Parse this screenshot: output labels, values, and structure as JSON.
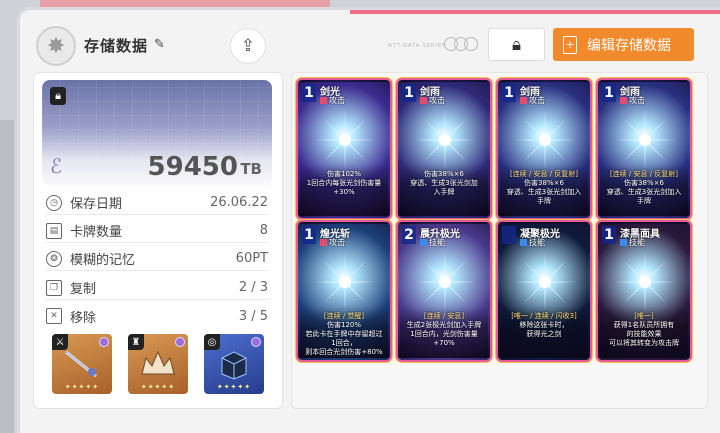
{
  "header": {
    "title": "存储数据",
    "brand_text": "NTT-DATA-SERIES",
    "edit_label": "编辑存储数据"
  },
  "storage": {
    "value": "59450",
    "unit": "TB"
  },
  "stats": [
    {
      "label": "保存日期",
      "value": "26.06.22",
      "icon": "clock-icon"
    },
    {
      "label": "卡牌数量",
      "value": "8",
      "icon": "cards-icon"
    },
    {
      "label": "模糊的记忆",
      "value": "60PT",
      "icon": "brain-icon"
    },
    {
      "label": "复制",
      "value": "2 / 3",
      "icon": "copy-icon"
    },
    {
      "label": "移除",
      "value": "3 / 5",
      "icon": "remove-icon"
    }
  ],
  "equipment": [
    {
      "stars": "✦✦✦✦✦",
      "color": "#c8803c",
      "badge": "⚔"
    },
    {
      "stars": "✦✦✦✦✦",
      "color": "#c8803c",
      "badge": "👕"
    },
    {
      "stars": "✦✦✦✦✦",
      "color": "#3a5bb8",
      "badge": "💍"
    }
  ],
  "cards": [
    {
      "cost": "1",
      "name": "剑光",
      "type": "攻击",
      "typeColor": "#e84a6a",
      "desc": [
        "伤害102%",
        "1回合内每张光剑伤害量",
        "+30%"
      ],
      "bg": "#3b2b8e"
    },
    {
      "cost": "1",
      "name": "剑雨",
      "type": "攻击",
      "typeColor": "#e84a6a",
      "desc": [
        "伤害38%×6",
        "穿透、生成3张光剑加",
        "入手牌"
      ],
      "bg": "#2f2a78"
    },
    {
      "cost": "1",
      "name": "剑雨",
      "type": "攻击",
      "typeColor": "#e84a6a",
      "desc": [
        "[连续 / 安息 / 反复射]",
        "伤害38%×6",
        "穿透、生成3张光剑加入手牌"
      ],
      "bg": "#2a3080"
    },
    {
      "cost": "1",
      "name": "剑雨",
      "type": "攻击",
      "typeColor": "#e84a6a",
      "desc": [
        "[连续 / 安息 / 反复射]",
        "伤害38%×6",
        "穿透、生成3张光剑加入手牌"
      ],
      "bg": "#2a3080"
    },
    {
      "cost": "1",
      "name": "煌光斩",
      "type": "攻击",
      "typeColor": "#e84a6a",
      "desc": [
        "[连续 / 觉醒]",
        "伤害120%",
        "若此卡在手牌中存留超过1回合，",
        "则本回合光剑伤害+80%"
      ],
      "bg": "#1d3f7a"
    },
    {
      "cost": "2",
      "name": "晨升极光",
      "type": "技能",
      "typeColor": "#3a8bea",
      "desc": [
        "[连续 / 安息]",
        "生成2张极光剑加入手牌",
        "1回合内，光剑伤害量",
        "+70%"
      ],
      "bg": "#4a3a8c"
    },
    {
      "cost": "",
      "name": "凝聚极光",
      "type": "技能",
      "typeColor": "#3a8bea",
      "desc": [
        "[唯一 / 连续 / 闪收3]",
        "移除这张卡时，",
        "获得光之剑"
      ],
      "bg": "#0f1a3a"
    },
    {
      "cost": "1",
      "name": "漆黑面具",
      "type": "技能",
      "typeColor": "#3a8bea",
      "desc": [
        "[唯一]",
        "获得1名队员所拥有",
        "的技能效果",
        "可以将其转变为攻击牌"
      ],
      "bg": "#2a1a3c"
    }
  ]
}
